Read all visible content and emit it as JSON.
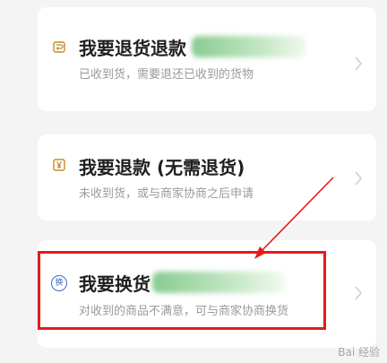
{
  "options": [
    {
      "title": "我要退货退款",
      "subtitle": "已收到货，需要退还已收到的货物",
      "icon": "return-box-icon"
    },
    {
      "title": "我要退款 (无需退货)",
      "subtitle": "未收到货，或与商家协商之后申请",
      "icon": "yen-icon"
    },
    {
      "title": "我要换货",
      "subtitle": "对收到的商品不满意，可与商家协商换货",
      "icon": "exchange-icon",
      "icon_text": "换"
    }
  ],
  "watermark": "Bai 经验",
  "colors": {
    "highlight": "#e41b1b",
    "icon": "#c58a2a",
    "exchange_icon": "#3f6cc7"
  }
}
